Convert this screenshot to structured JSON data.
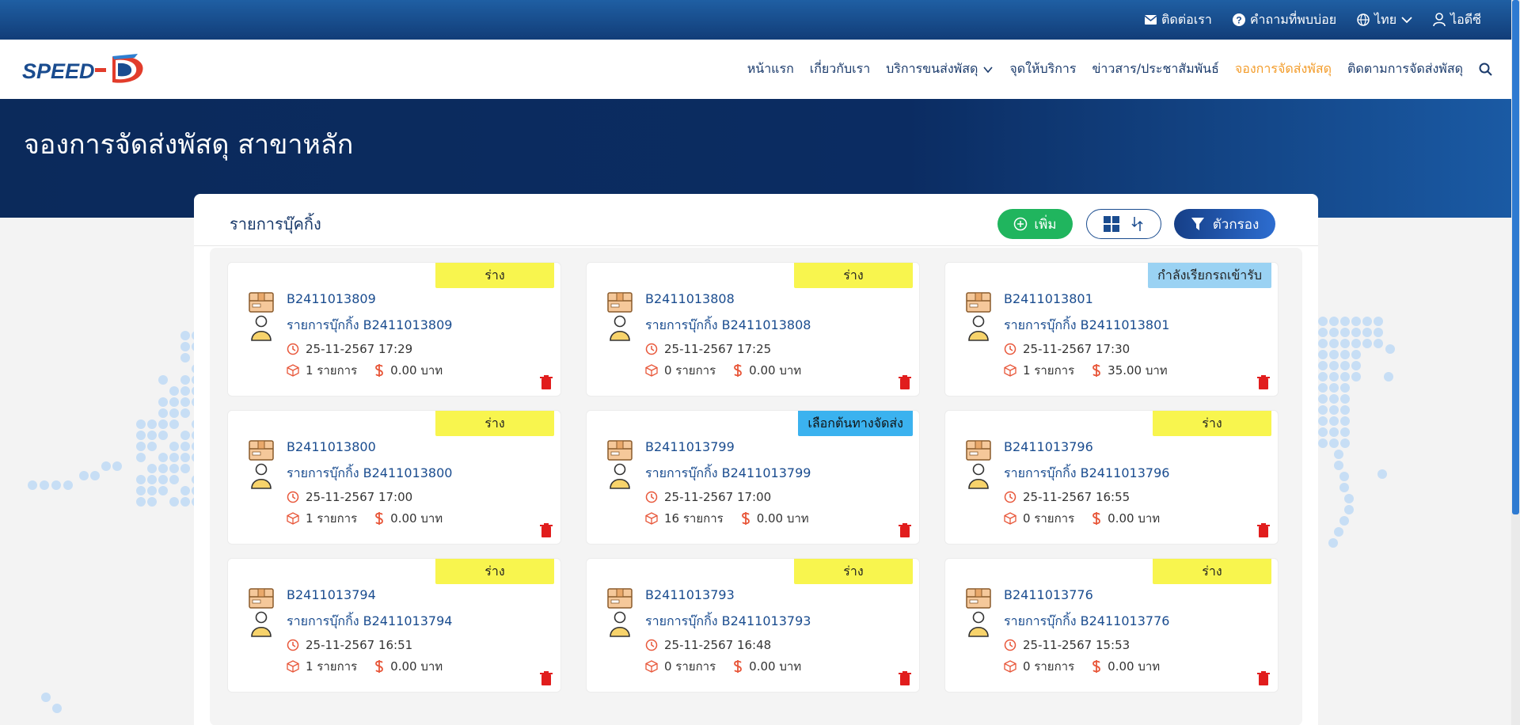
{
  "topbar": {
    "contact": "ติดต่อเรา",
    "faq": "คำถามที่พบบ่อย",
    "language": "ไทย",
    "user": "ไอดีซี"
  },
  "logo": {
    "text": "SPEED-D"
  },
  "nav": {
    "items": [
      "หน้าแรก",
      "เกี่ยวกับเรา",
      "บริการขนส่งพัสดุ",
      "จุดให้บริการ",
      "ข่าวสาร/ประชาสัมพันธ์",
      "จองการจัดส่งพัสดุ",
      "ติดตามการจัดส่งพัสดุ"
    ],
    "active_index": 5
  },
  "hero": {
    "title": "จองการจัดส่งพัสดุ สาขาหลัก"
  },
  "panel": {
    "title": "รายการบุ๊คกิ้ง",
    "add_label": "เพิ่ม",
    "filter_label": "ตัวกรอง"
  },
  "colors": {
    "draft_badge": "#f8f54e",
    "calling_badge": "#9ad2f3",
    "route_badge": "#3bb2ef",
    "accent_orange": "#f39c2a",
    "navy": "#1a3a6b",
    "add_green": "#20b55e",
    "trash_red": "#e11d1d"
  },
  "cards": [
    {
      "status": "ร่าง",
      "status_type": "draft",
      "code": "B2411013809",
      "name": "รายการบุ๊กกิ้ง B2411013809",
      "datetime": "25-11-2567 17:29",
      "items": "1 รายการ",
      "amount": "0.00 บาท"
    },
    {
      "status": "ร่าง",
      "status_type": "draft",
      "code": "B2411013808",
      "name": "รายการบุ๊กกิ้ง B2411013808",
      "datetime": "25-11-2567 17:25",
      "items": "0 รายการ",
      "amount": "0.00 บาท"
    },
    {
      "status": "กำลังเรียกรถเข้ารับ",
      "status_type": "calling",
      "code": "B2411013801",
      "name": "รายการบุ๊กกิ้ง B2411013801",
      "datetime": "25-11-2567 17:30",
      "items": "1 รายการ",
      "amount": "35.00 บาท"
    },
    {
      "status": "ร่าง",
      "status_type": "draft",
      "code": "B2411013800",
      "name": "รายการบุ๊กกิ้ง B2411013800",
      "datetime": "25-11-2567 17:00",
      "items": "1 รายการ",
      "amount": "0.00 บาท"
    },
    {
      "status": "เลือกต้นทางจัดส่ง",
      "status_type": "route",
      "code": "B2411013799",
      "name": "รายการบุ๊กกิ้ง B2411013799",
      "datetime": "25-11-2567 17:00",
      "items": "16 รายการ",
      "amount": "0.00 บาท"
    },
    {
      "status": "ร่าง",
      "status_type": "draft",
      "code": "B2411013796",
      "name": "รายการบุ๊กกิ้ง B2411013796",
      "datetime": "25-11-2567 16:55",
      "items": "0 รายการ",
      "amount": "0.00 บาท"
    },
    {
      "status": "ร่าง",
      "status_type": "draft",
      "code": "B2411013794",
      "name": "รายการบุ๊กกิ้ง B2411013794",
      "datetime": "25-11-2567 16:51",
      "items": "1 รายการ",
      "amount": "0.00 บาท"
    },
    {
      "status": "ร่าง",
      "status_type": "draft",
      "code": "B2411013793",
      "name": "รายการบุ๊กกิ้ง B2411013793",
      "datetime": "25-11-2567 16:48",
      "items": "0 รายการ",
      "amount": "0.00 บาท"
    },
    {
      "status": "ร่าง",
      "status_type": "draft",
      "code": "B2411013776",
      "name": "รายการบุ๊กกิ้ง B2411013776",
      "datetime": "25-11-2567 15:53",
      "items": "0 รายการ",
      "amount": "0.00 บาท"
    }
  ]
}
